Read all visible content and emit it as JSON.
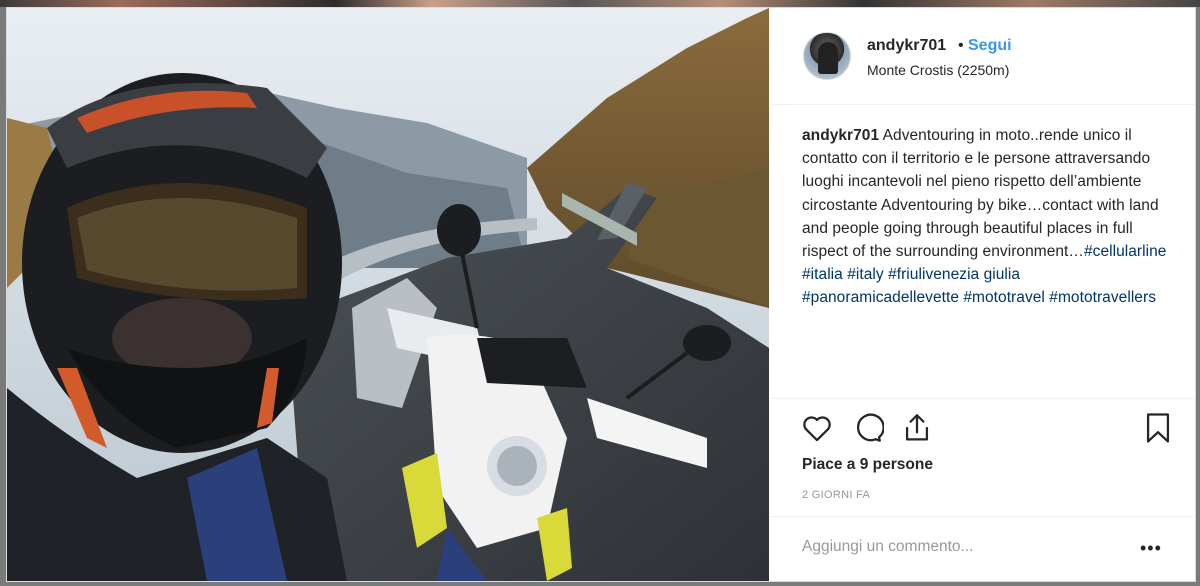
{
  "post": {
    "username": "andykr701",
    "separator": "•",
    "follow_label": "Segui",
    "location": "Monte Crostis (2250m)",
    "caption": {
      "username": "andykr701",
      "text": " Adventouring in moto..rende unico il contatto con il territorio e le persone attraversando luoghi incantevoli nel pieno rispetto dell’ambiente circostante Adventouring by bike…contact with land and people going through beautiful places in full rispect of the surrounding environment…",
      "hashtags": [
        "#cellularline",
        "#italia",
        "#italy",
        "#friulivenezia giulia",
        "#panoramicadellevette",
        "#mototravel",
        "#mototravellers"
      ]
    },
    "likes_text": "Piace a 9 persone",
    "timestamp": "2 GIORNI FA",
    "comment_placeholder": "Aggiungi un commento...",
    "more_label": "•••",
    "icons": [
      "heart-icon",
      "comment-icon",
      "share-icon",
      "bookmark-icon"
    ],
    "colors": {
      "link": "#3897f0",
      "hashtag": "#003569",
      "text": "#262626",
      "muted": "#999999"
    }
  }
}
